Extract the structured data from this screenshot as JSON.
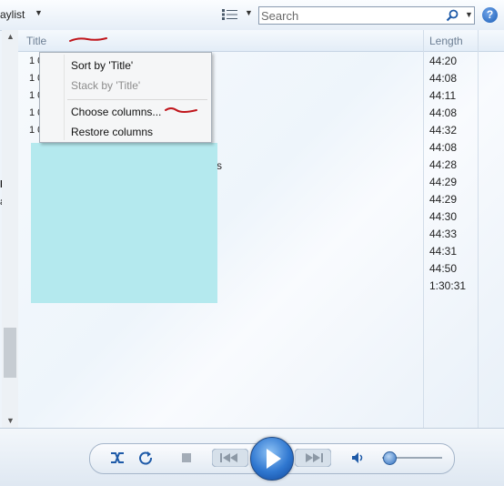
{
  "toolbar": {
    "playlist_label": "aylist",
    "search_placeholder": "Search",
    "help_symbol": "?"
  },
  "left_fragments": [
    "l",
    "a"
  ],
  "list": {
    "columns": {
      "title": "Title",
      "length": "Length"
    },
    "row_prefixes": [
      "1 0",
      "1 0",
      "1 0",
      "1 0",
      "1 0"
    ],
    "lengths": [
      "44:20",
      "44:08",
      "44:11",
      "44:08",
      "44:32",
      "44:08",
      "44:28",
      "44:29",
      "44:29",
      "44:30",
      "44:33",
      "44:31",
      "44:50",
      "1:30:31"
    ],
    "partial_title_char": "s"
  },
  "context_menu": {
    "items": [
      {
        "label": "Sort by 'Title'",
        "enabled": true
      },
      {
        "label": "Stack by 'Title'",
        "enabled": false
      },
      {
        "label": "Choose columns...",
        "enabled": true
      },
      {
        "label": "Restore columns",
        "enabled": true
      }
    ]
  },
  "playback": {
    "volume_level": 0.12,
    "redaction_color": "#b4e9ee",
    "accent_color": "#2f77d0"
  }
}
